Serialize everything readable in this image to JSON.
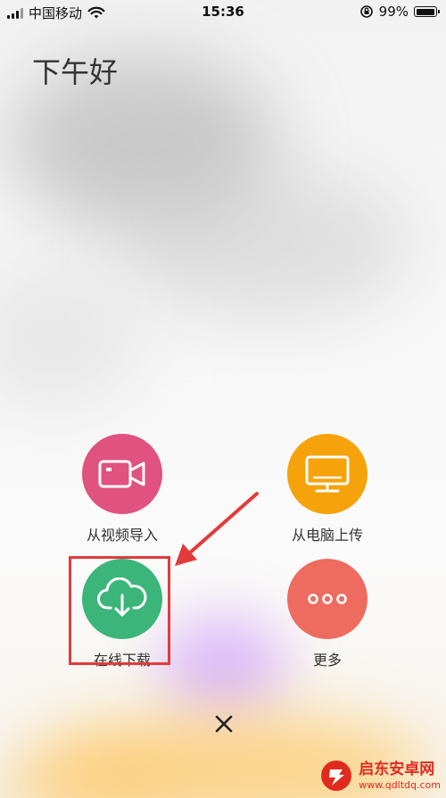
{
  "status_bar": {
    "carrier": "中国移动",
    "time": "15:36",
    "battery": "99%",
    "battery_level": 0.99
  },
  "greeting": "下午好",
  "actions": [
    {
      "label": "从视频导入",
      "icon": "video-camera-icon",
      "color": "#E0527F"
    },
    {
      "label": "从电脑上传",
      "icon": "monitor-icon",
      "color": "#F5A20B"
    },
    {
      "label": "在线下载",
      "icon": "cloud-download-icon",
      "color": "#3BB57A"
    },
    {
      "label": "更多",
      "icon": "more-dots-icon",
      "color": "#EE6B5F"
    }
  ],
  "annotation_color": "#E23B3B",
  "watermark": {
    "title": "启东安卓网",
    "url": "www.qdltdq.com"
  }
}
